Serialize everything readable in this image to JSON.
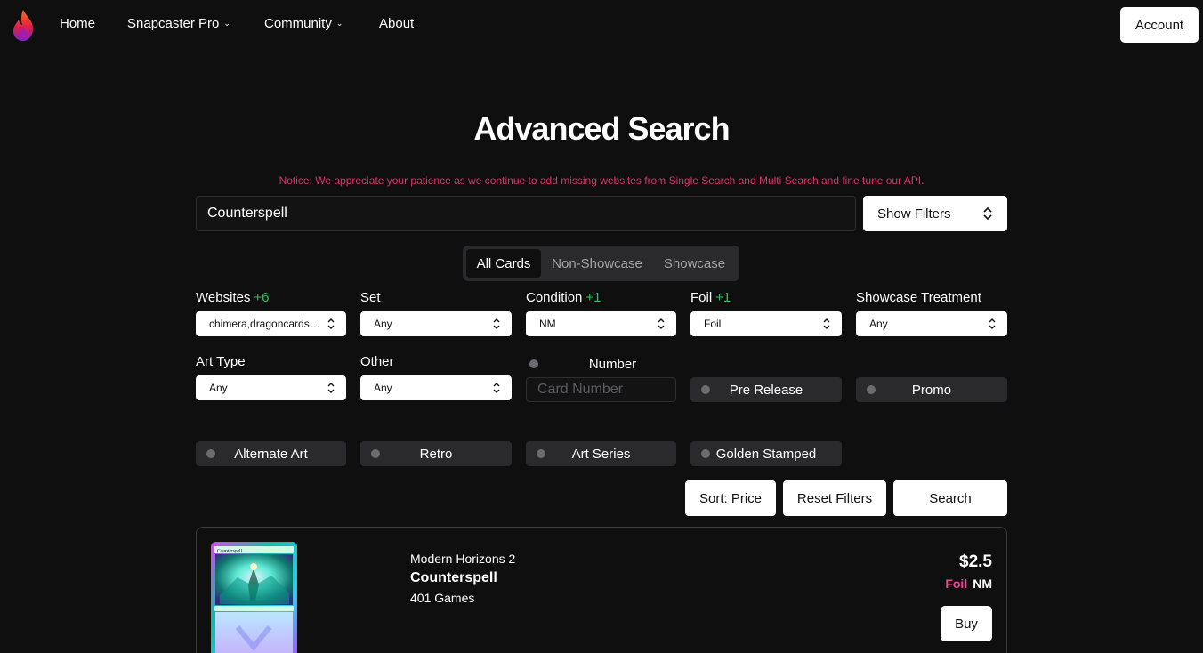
{
  "nav": {
    "home": "Home",
    "pro": "Snapcaster Pro",
    "community": "Community",
    "about": "About",
    "account": "Account"
  },
  "page": {
    "title": "Advanced Search",
    "notice": "Notice: We appreciate your patience as we continue to add missing websites from Single Search and Multi Search and fine tune our API."
  },
  "search": {
    "value": "Counterspell",
    "show_filters": "Show Filters"
  },
  "segments": [
    "All Cards",
    "Non-Showcase",
    "Showcase"
  ],
  "filters": {
    "websites": {
      "label": "Websites",
      "badge": "+6",
      "value": "chimera,dragoncards,..."
    },
    "set": {
      "label": "Set",
      "value": "Any"
    },
    "condition": {
      "label": "Condition",
      "badge": "+1",
      "value": "NM"
    },
    "foil": {
      "label": "Foil",
      "badge": "+1",
      "value": "Foil"
    },
    "showcase_treatment": {
      "label": "Showcase Treatment",
      "value": "Any"
    },
    "art_type": {
      "label": "Art Type",
      "value": "Any"
    },
    "other": {
      "label": "Other",
      "value": "Any"
    },
    "number": {
      "label": "Number",
      "placeholder": "Card Number"
    },
    "toggles": {
      "pre_release": "Pre Release",
      "promo": "Promo",
      "alternate_art": "Alternate Art",
      "retro": "Retro",
      "art_series": "Art Series",
      "golden_stamped": "Golden Stamped"
    }
  },
  "actions": {
    "sort": "Sort: Price",
    "reset": "Reset Filters",
    "search": "Search"
  },
  "result": {
    "set": "Modern Horizons 2",
    "name": "Counterspell",
    "website": "401 Games",
    "price": "$2.5",
    "foil": "Foil",
    "condition": "NM",
    "buy": "Buy",
    "card_title": "Counterspell"
  },
  "colors": {
    "background": "#0f0f10",
    "notice": "#e0306c",
    "badge": "#22c55e",
    "foil": "#ec4899"
  }
}
